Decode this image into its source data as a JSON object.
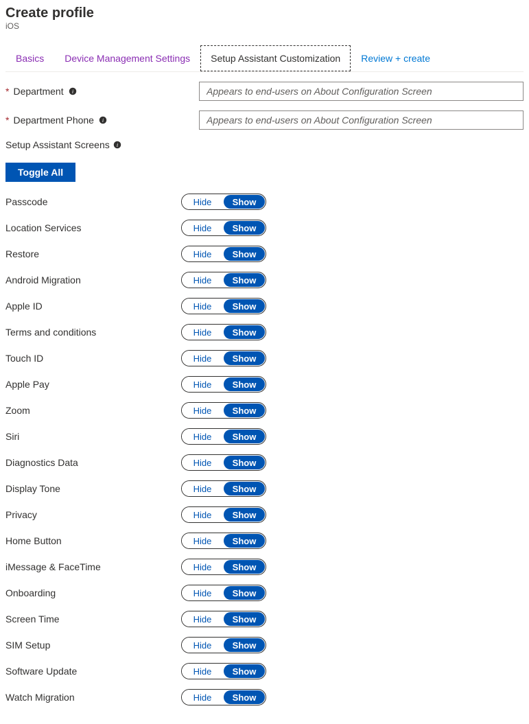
{
  "header": {
    "title": "Create profile",
    "subtitle": "iOS"
  },
  "tabs": [
    {
      "label": "Basics",
      "state": "visited"
    },
    {
      "label": "Device Management Settings",
      "state": "visited"
    },
    {
      "label": "Setup Assistant Customization",
      "state": "active"
    },
    {
      "label": "Review + create",
      "state": "default"
    }
  ],
  "fields": {
    "department_label": "Department",
    "department_placeholder": "Appears to end-users on About Configuration Screen",
    "department_phone_label": "Department Phone",
    "department_phone_placeholder": "Appears to end-users on About Configuration Screen"
  },
  "section_label": "Setup Assistant Screens",
  "toggle_all_label": "Toggle All",
  "toggle_options": {
    "hide": "Hide",
    "show": "Show"
  },
  "screens": [
    {
      "label": "Passcode",
      "value": "show"
    },
    {
      "label": "Location Services",
      "value": "show"
    },
    {
      "label": "Restore",
      "value": "show"
    },
    {
      "label": "Android Migration",
      "value": "show"
    },
    {
      "label": "Apple ID",
      "value": "show"
    },
    {
      "label": "Terms and conditions",
      "value": "show"
    },
    {
      "label": "Touch ID",
      "value": "show"
    },
    {
      "label": "Apple Pay",
      "value": "show"
    },
    {
      "label": "Zoom",
      "value": "show"
    },
    {
      "label": "Siri",
      "value": "show"
    },
    {
      "label": "Diagnostics Data",
      "value": "show"
    },
    {
      "label": "Display Tone",
      "value": "show"
    },
    {
      "label": "Privacy",
      "value": "show"
    },
    {
      "label": "Home Button",
      "value": "show"
    },
    {
      "label": "iMessage & FaceTime",
      "value": "show"
    },
    {
      "label": "Onboarding",
      "value": "show"
    },
    {
      "label": "Screen Time",
      "value": "show"
    },
    {
      "label": "SIM Setup",
      "value": "show"
    },
    {
      "label": "Software Update",
      "value": "show"
    },
    {
      "label": "Watch Migration",
      "value": "show"
    }
  ]
}
